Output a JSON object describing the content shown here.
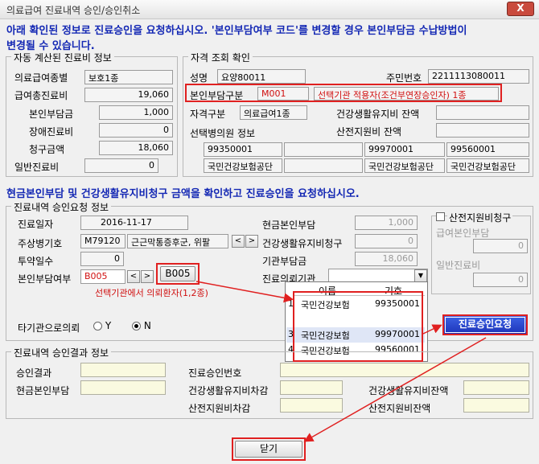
{
  "window": {
    "title": "의료급여 진료내역 승인/승인취소",
    "close_label": "X"
  },
  "notice1": "아래 확인된 정보로 진료승인을 요청하십시오. '본인부담여부 코드'를 변경할 경우 본인부담금 수납방법이",
  "notice1b": "변경될 수 있습니다.",
  "auto": {
    "legend": "자동 계산된 진료비 정보",
    "type_label": "의료급여종별",
    "type_value": "보호1종",
    "total_label": "급여총진료비",
    "total_value": "19,060",
    "self_label": "본인부담금",
    "self_value": "1,000",
    "disab_label": "장애진료비",
    "disab_value": "0",
    "claim_label": "청구금액",
    "claim_value": "18,060",
    "general_label": "일반진료비",
    "general_value": "0"
  },
  "elig": {
    "legend": "자격 조회 확인",
    "name_label": "성명",
    "name_value": "요양80011",
    "id_label": "주민번호",
    "id_value": "2211113080011",
    "copay_label": "본인부담구분",
    "copay_code": "M001",
    "copay_desc": "선택기관 적용자(조건부연장승인자) 1종",
    "qual_label": "자격구분",
    "qual_value": "의료급여1종",
    "health_label": "건강생활유지비 잔액",
    "health_value": "",
    "birth_label": "산전지원비 잔액",
    "birth_value": "",
    "clinic_label": "선택병의원 정보",
    "clinic_codes": [
      "99350001",
      "",
      "99970001",
      "99560001"
    ],
    "clinic_names": [
      "국민건강보험공단",
      "",
      "국민건강보험공단",
      "국민건강보험공단"
    ]
  },
  "notice2": "현금본인부담 및 건강생활유지비청구 금액을 확인하고 진료승인을 요청하십시오.",
  "req": {
    "legend": "진료내역 승인요청 정보",
    "date_label": "진료일자",
    "date_value": "2016-11-17",
    "diag_label": "주상병기호",
    "diag_code": "M79120",
    "diag_name": "근근막통증후군, 위팔",
    "days_label": "투약일수",
    "days_value": "0",
    "copay_label": "본인부담여부",
    "copay_code": "B005",
    "copay_btn": "B005",
    "copay_note": "선택기관에서 의뢰환자(1,2종)",
    "cash_label": "현금본인부담",
    "cash_value": "1,000",
    "hclaim_label": "건강생활유지비청구",
    "hclaim_value": "0",
    "inst_label": "기관부담금",
    "inst_value": "18,060",
    "refer_label": "진료의뢰기관",
    "refer_value": "",
    "birth_chk_label": "산전지원비청구",
    "bself_label": "급여본인부담",
    "bself_value": "0",
    "bgen_label": "일반진료비",
    "bgen_value": "0",
    "other_label": "타기관으로의뢰",
    "opt_y": "Y",
    "opt_n": "N",
    "submit_label": "진료승인요청",
    "dropdown": {
      "col_name": "이름",
      "col_code": "기호",
      "rows": [
        {
          "idx": "1",
          "name": "국민건강보험",
          "code": "99350001"
        },
        {
          "idx": "",
          "name": "",
          "code": ""
        },
        {
          "idx": "3",
          "name": "국민건강보험",
          "code": "99970001"
        },
        {
          "idx": "4",
          "name": "국민건강보험",
          "code": "99560001"
        }
      ]
    }
  },
  "result": {
    "legend": "진료내역 승인결과 정보",
    "appr_label": "승인결과",
    "apprno_label": "진료승인번호",
    "cash_label": "현금본인부담",
    "hdiff_label": "건강생활유지비차감",
    "hbal_label": "건강생활유지비잔액",
    "bdiff_label": "산전지원비차감",
    "bbal_label": "산전지원비잔액"
  },
  "close_label": "닫기",
  "colors": {
    "accent": "#1428b4",
    "alert": "#e02020"
  }
}
